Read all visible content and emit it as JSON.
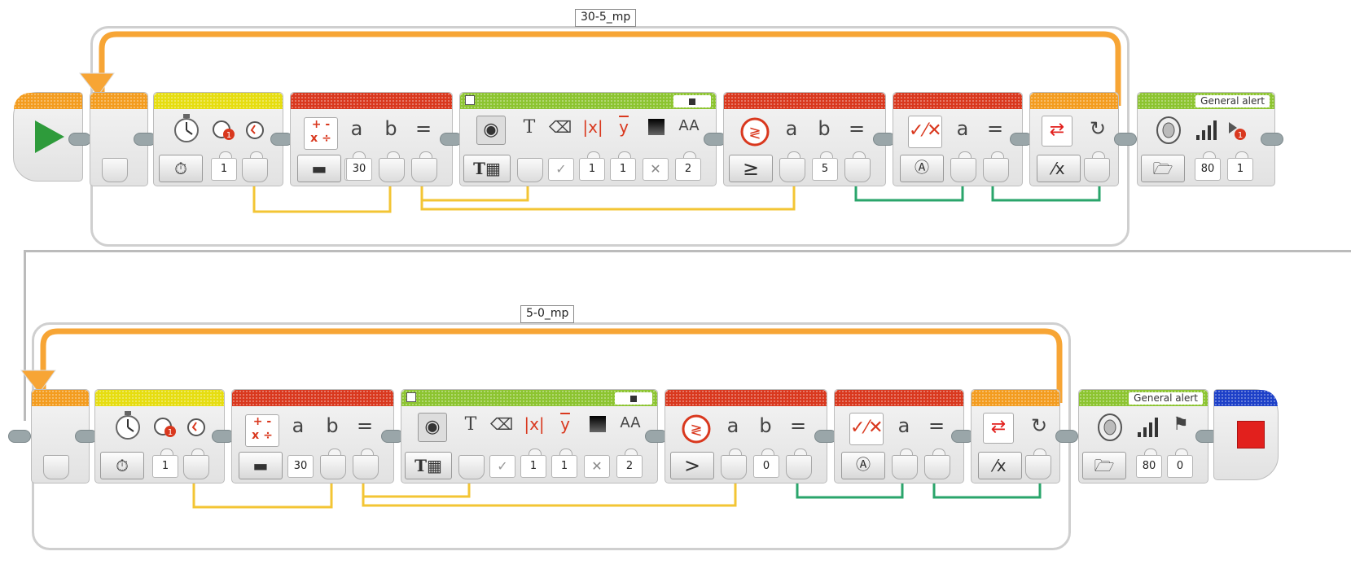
{
  "loops": [
    {
      "name": "30-5_mp",
      "timer_id": "1",
      "math_b": "30",
      "display": {
        "color": "1",
        "size_x": "1",
        "font": "2"
      },
      "compare_op": "≥",
      "compare_b": "5",
      "sound_title": "General alert",
      "sound_volume": "80",
      "sound_play_type": "1"
    },
    {
      "name": "5-0_mp",
      "timer_id": "1",
      "math_b": "30",
      "display": {
        "color": "1",
        "size_x": "1",
        "font": "2"
      },
      "compare_op": ">",
      "compare_b": "0",
      "sound_title": "General alert",
      "sound_volume": "80",
      "sound_play_type": "0"
    }
  ],
  "labels": {
    "a": "a",
    "b": "b",
    "eq": "="
  },
  "colors": {
    "flow_yellow": "#e6dd10",
    "data_red": "#d9381e",
    "action_green": "#8cc430",
    "flow_orange": "#f39c1f",
    "stop_blue": "#1d40c8",
    "wire_yellow": "#f3c534",
    "wire_green": "#2aa56b",
    "loop_arrow": "#f7a535",
    "start_green": "#2e9b3b",
    "stop_red": "#e2201d"
  },
  "icons": [
    "start-play-icon",
    "timer-icon",
    "math-icon",
    "display-icon",
    "compare-icon",
    "logic-icon",
    "loop-interrupt-icon",
    "speaker-icon",
    "volume-bars-icon",
    "play-once-icon",
    "checkered-flag-icon",
    "stop-icon",
    "folder-icon"
  ]
}
